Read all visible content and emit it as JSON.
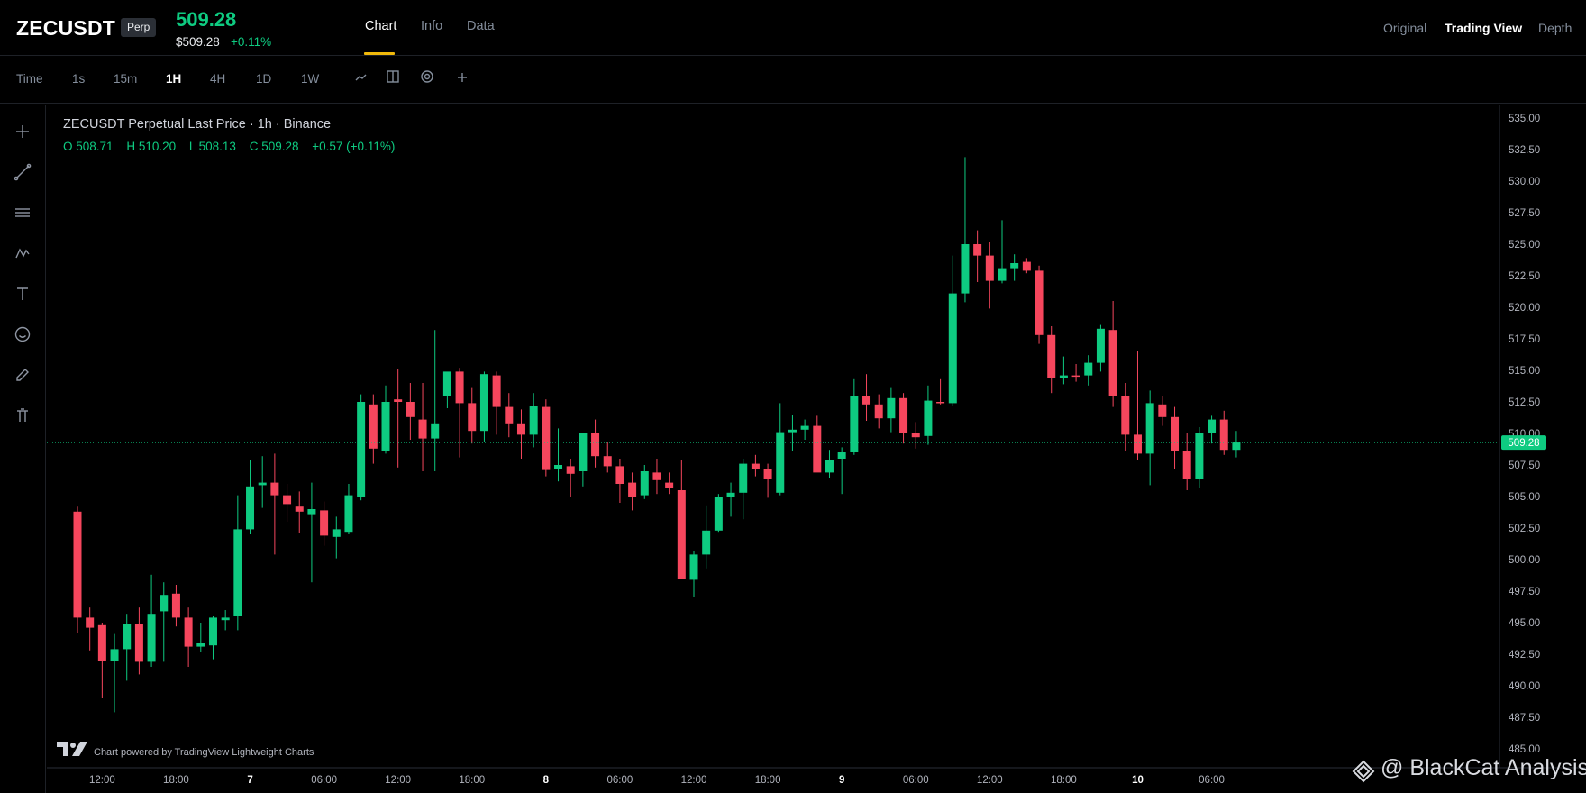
{
  "header": {
    "symbol": "ZECUSDT",
    "badge": "Perp",
    "last_price": "509.28",
    "sub_price": "$509.28",
    "sub_change": "+0.11%",
    "tabs": [
      "Chart",
      "Info",
      "Data"
    ],
    "active_tab": "Chart",
    "view_tabs": [
      "Original",
      "Trading View",
      "Depth"
    ],
    "active_view": "Trading View"
  },
  "toolbar": {
    "time_label": "Time",
    "intervals": [
      "1s",
      "15m",
      "1H",
      "4H",
      "1D",
      "1W"
    ],
    "active_interval": "1H",
    "icons": [
      "line-type-icon",
      "compare-icon",
      "indicators-icon",
      "add-icon"
    ]
  },
  "left_tools": [
    "crosshair-icon",
    "trendline-icon",
    "horizontal-lines-icon",
    "pattern-icon",
    "text-icon",
    "emoji-icon",
    "brush-icon",
    "trash-icon"
  ],
  "legend": {
    "title": "ZECUSDT Perpetual Last Price · 1h · Binance",
    "open": "O 508.71",
    "high": "H 510.20",
    "low": "L 508.13",
    "close": "C 509.28",
    "change": "+0.57 (+0.11%)"
  },
  "colors": {
    "up": "#0ecb81",
    "down": "#f6465d",
    "accent": "#f0b90b",
    "background": "#000000"
  },
  "footer": {
    "powered_by": "Chart powered by TradingView Lightweight Charts",
    "watermark": "@ BlackCat Analysis"
  },
  "chart_data": {
    "type": "candlestick",
    "interval": "1h",
    "last_price_label": "509.28",
    "last_price": 509.28,
    "ylim": [
      485,
      535
    ],
    "y_ticks": [
      "535.00",
      "532.50",
      "530.00",
      "527.50",
      "525.00",
      "522.50",
      "520.00",
      "517.50",
      "515.00",
      "512.50",
      "510.00",
      "507.50",
      "505.00",
      "502.50",
      "500.00",
      "497.50",
      "495.00",
      "492.50",
      "490.00",
      "487.50",
      "485.00"
    ],
    "x_ticks": [
      {
        "label": "12:00",
        "index": 2
      },
      {
        "label": "18:00",
        "index": 8
      },
      {
        "label": "7",
        "index": 14
      },
      {
        "label": "06:00",
        "index": 20
      },
      {
        "label": "12:00",
        "index": 26
      },
      {
        "label": "18:00",
        "index": 32
      },
      {
        "label": "8",
        "index": 38
      },
      {
        "label": "06:00",
        "index": 44
      },
      {
        "label": "12:00",
        "index": 50
      },
      {
        "label": "18:00",
        "index": 56
      },
      {
        "label": "9",
        "index": 62
      },
      {
        "label": "06:00",
        "index": 68
      },
      {
        "label": "12:00",
        "index": 74
      },
      {
        "label": "18:00",
        "index": 80
      },
      {
        "label": "10",
        "index": 86
      },
      {
        "label": "06:00",
        "index": 92
      }
    ],
    "candles": [
      {
        "o": 503.8,
        "h": 504.2,
        "l": 494.2,
        "c": 495.4
      },
      {
        "o": 495.4,
        "h": 496.2,
        "l": 492.8,
        "c": 494.6
      },
      {
        "o": 494.8,
        "h": 495.0,
        "l": 489.0,
        "c": 492.0
      },
      {
        "o": 492.0,
        "h": 494.1,
        "l": 487.9,
        "c": 492.9
      },
      {
        "o": 492.9,
        "h": 495.7,
        "l": 490.4,
        "c": 494.9
      },
      {
        "o": 494.9,
        "h": 496.2,
        "l": 490.9,
        "c": 491.9
      },
      {
        "o": 491.9,
        "h": 498.8,
        "l": 491.5,
        "c": 495.7
      },
      {
        "o": 495.9,
        "h": 498.2,
        "l": 491.9,
        "c": 497.2
      },
      {
        "o": 497.3,
        "h": 498.0,
        "l": 494.7,
        "c": 495.4
      },
      {
        "o": 495.4,
        "h": 496.2,
        "l": 491.5,
        "c": 493.1
      },
      {
        "o": 493.1,
        "h": 495.0,
        "l": 492.7,
        "c": 493.4
      },
      {
        "o": 493.2,
        "h": 495.5,
        "l": 492.1,
        "c": 495.4
      },
      {
        "o": 495.2,
        "h": 496.0,
        "l": 494.4,
        "c": 495.4
      },
      {
        "o": 495.5,
        "h": 505.1,
        "l": 494.4,
        "c": 502.4
      },
      {
        "o": 502.4,
        "h": 507.9,
        "l": 502.0,
        "c": 505.8
      },
      {
        "o": 505.9,
        "h": 508.2,
        "l": 504.1,
        "c": 506.1
      },
      {
        "o": 506.1,
        "h": 508.4,
        "l": 500.4,
        "c": 505.1
      },
      {
        "o": 505.1,
        "h": 506.0,
        "l": 503.0,
        "c": 504.4
      },
      {
        "o": 504.2,
        "h": 505.4,
        "l": 502.1,
        "c": 503.8
      },
      {
        "o": 503.6,
        "h": 506.1,
        "l": 498.2,
        "c": 504.0
      },
      {
        "o": 503.9,
        "h": 504.6,
        "l": 501.1,
        "c": 501.9
      },
      {
        "o": 501.8,
        "h": 503.4,
        "l": 500.1,
        "c": 502.4
      },
      {
        "o": 502.2,
        "h": 506.0,
        "l": 502.0,
        "c": 505.1
      },
      {
        "o": 505.0,
        "h": 513.1,
        "l": 504.7,
        "c": 512.5
      },
      {
        "o": 512.3,
        "h": 513.1,
        "l": 507.6,
        "c": 508.8
      },
      {
        "o": 508.6,
        "h": 513.8,
        "l": 508.4,
        "c": 512.5
      },
      {
        "o": 512.7,
        "h": 515.1,
        "l": 507.3,
        "c": 512.5
      },
      {
        "o": 512.5,
        "h": 514.0,
        "l": 509.5,
        "c": 511.3
      },
      {
        "o": 511.1,
        "h": 514.0,
        "l": 507.0,
        "c": 509.6
      },
      {
        "o": 509.6,
        "h": 518.2,
        "l": 507.0,
        "c": 510.8
      },
      {
        "o": 513.0,
        "h": 514.1,
        "l": 512.0,
        "c": 514.9
      },
      {
        "o": 514.9,
        "h": 515.2,
        "l": 508.1,
        "c": 512.4
      },
      {
        "o": 512.4,
        "h": 513.6,
        "l": 509.2,
        "c": 510.2
      },
      {
        "o": 510.2,
        "h": 514.9,
        "l": 509.3,
        "c": 514.7
      },
      {
        "o": 514.6,
        "h": 514.9,
        "l": 509.9,
        "c": 512.1
      },
      {
        "o": 512.1,
        "h": 513.2,
        "l": 509.7,
        "c": 510.8
      },
      {
        "o": 510.8,
        "h": 511.9,
        "l": 508.0,
        "c": 509.9
      },
      {
        "o": 509.9,
        "h": 513.2,
        "l": 508.9,
        "c": 512.2
      },
      {
        "o": 512.1,
        "h": 512.7,
        "l": 506.6,
        "c": 507.1
      },
      {
        "o": 507.2,
        "h": 510.4,
        "l": 506.2,
        "c": 507.5
      },
      {
        "o": 507.4,
        "h": 508.0,
        "l": 505.0,
        "c": 506.8
      },
      {
        "o": 507.0,
        "h": 510.0,
        "l": 505.8,
        "c": 510.0
      },
      {
        "o": 510.0,
        "h": 511.1,
        "l": 507.3,
        "c": 508.2
      },
      {
        "o": 508.2,
        "h": 509.3,
        "l": 506.9,
        "c": 507.4
      },
      {
        "o": 507.4,
        "h": 508.0,
        "l": 504.5,
        "c": 506.0
      },
      {
        "o": 506.1,
        "h": 506.9,
        "l": 503.9,
        "c": 505.0
      },
      {
        "o": 505.1,
        "h": 507.5,
        "l": 504.8,
        "c": 507.0
      },
      {
        "o": 506.9,
        "h": 508.0,
        "l": 505.2,
        "c": 506.3
      },
      {
        "o": 506.1,
        "h": 506.9,
        "l": 505.2,
        "c": 505.7
      },
      {
        "o": 505.5,
        "h": 507.9,
        "l": 500.4,
        "c": 498.5
      },
      {
        "o": 498.4,
        "h": 500.7,
        "l": 497.0,
        "c": 500.4
      },
      {
        "o": 500.4,
        "h": 504.3,
        "l": 499.3,
        "c": 502.3
      },
      {
        "o": 502.3,
        "h": 505.2,
        "l": 502.2,
        "c": 505.0
      },
      {
        "o": 505.0,
        "h": 506.1,
        "l": 503.4,
        "c": 505.3
      },
      {
        "o": 505.3,
        "h": 508.0,
        "l": 503.2,
        "c": 507.6
      },
      {
        "o": 507.6,
        "h": 508.3,
        "l": 506.6,
        "c": 507.2
      },
      {
        "o": 507.2,
        "h": 507.6,
        "l": 504.9,
        "c": 506.4
      },
      {
        "o": 505.3,
        "h": 512.4,
        "l": 505.1,
        "c": 510.1
      },
      {
        "o": 510.1,
        "h": 511.5,
        "l": 508.6,
        "c": 510.3
      },
      {
        "o": 510.3,
        "h": 511.1,
        "l": 509.5,
        "c": 510.6
      },
      {
        "o": 510.6,
        "h": 511.4,
        "l": 507.2,
        "c": 506.9
      },
      {
        "o": 506.9,
        "h": 508.7,
        "l": 506.5,
        "c": 507.9
      },
      {
        "o": 508.0,
        "h": 508.9,
        "l": 505.2,
        "c": 508.5
      },
      {
        "o": 508.5,
        "h": 514.3,
        "l": 508.3,
        "c": 513.0
      },
      {
        "o": 513.0,
        "h": 514.7,
        "l": 511.0,
        "c": 512.3
      },
      {
        "o": 512.3,
        "h": 513.1,
        "l": 510.4,
        "c": 511.2
      },
      {
        "o": 511.2,
        "h": 513.6,
        "l": 510.1,
        "c": 512.8
      },
      {
        "o": 512.8,
        "h": 513.2,
        "l": 509.2,
        "c": 510.0
      },
      {
        "o": 510.0,
        "h": 510.9,
        "l": 508.8,
        "c": 509.7
      },
      {
        "o": 509.8,
        "h": 513.8,
        "l": 509.1,
        "c": 512.6
      },
      {
        "o": 512.5,
        "h": 514.3,
        "l": 512.3,
        "c": 512.4
      },
      {
        "o": 512.4,
        "h": 524.1,
        "l": 512.2,
        "c": 521.1
      },
      {
        "o": 521.1,
        "h": 531.9,
        "l": 520.4,
        "c": 525.0
      },
      {
        "o": 525.0,
        "h": 526.1,
        "l": 522.0,
        "c": 524.1
      },
      {
        "o": 524.1,
        "h": 525.2,
        "l": 519.9,
        "c": 522.1
      },
      {
        "o": 522.1,
        "h": 526.9,
        "l": 521.9,
        "c": 523.1
      },
      {
        "o": 523.1,
        "h": 524.2,
        "l": 522.1,
        "c": 523.5
      },
      {
        "o": 523.6,
        "h": 523.9,
        "l": 522.7,
        "c": 522.9
      },
      {
        "o": 522.9,
        "h": 523.3,
        "l": 517.1,
        "c": 517.8
      },
      {
        "o": 517.8,
        "h": 518.5,
        "l": 513.2,
        "c": 514.4
      },
      {
        "o": 514.4,
        "h": 516.1,
        "l": 513.9,
        "c": 514.6
      },
      {
        "o": 514.6,
        "h": 515.5,
        "l": 514.1,
        "c": 514.5
      },
      {
        "o": 514.6,
        "h": 516.2,
        "l": 513.8,
        "c": 515.6
      },
      {
        "o": 515.6,
        "h": 518.6,
        "l": 514.9,
        "c": 518.3
      },
      {
        "o": 518.2,
        "h": 520.5,
        "l": 512.1,
        "c": 513.0
      },
      {
        "o": 513.0,
        "h": 514.0,
        "l": 508.6,
        "c": 509.9
      },
      {
        "o": 509.9,
        "h": 516.5,
        "l": 507.9,
        "c": 508.4
      },
      {
        "o": 508.4,
        "h": 513.4,
        "l": 505.9,
        "c": 512.4
      },
      {
        "o": 512.3,
        "h": 513.0,
        "l": 510.6,
        "c": 511.3
      },
      {
        "o": 511.3,
        "h": 512.1,
        "l": 507.2,
        "c": 508.6
      },
      {
        "o": 508.6,
        "h": 510.0,
        "l": 505.5,
        "c": 506.4
      },
      {
        "o": 506.4,
        "h": 510.5,
        "l": 505.7,
        "c": 510.0
      },
      {
        "o": 510.0,
        "h": 511.4,
        "l": 509.2,
        "c": 511.1
      },
      {
        "o": 511.1,
        "h": 511.8,
        "l": 508.3,
        "c": 508.7
      },
      {
        "o": 508.7,
        "h": 510.2,
        "l": 508.1,
        "c": 509.28
      }
    ]
  }
}
